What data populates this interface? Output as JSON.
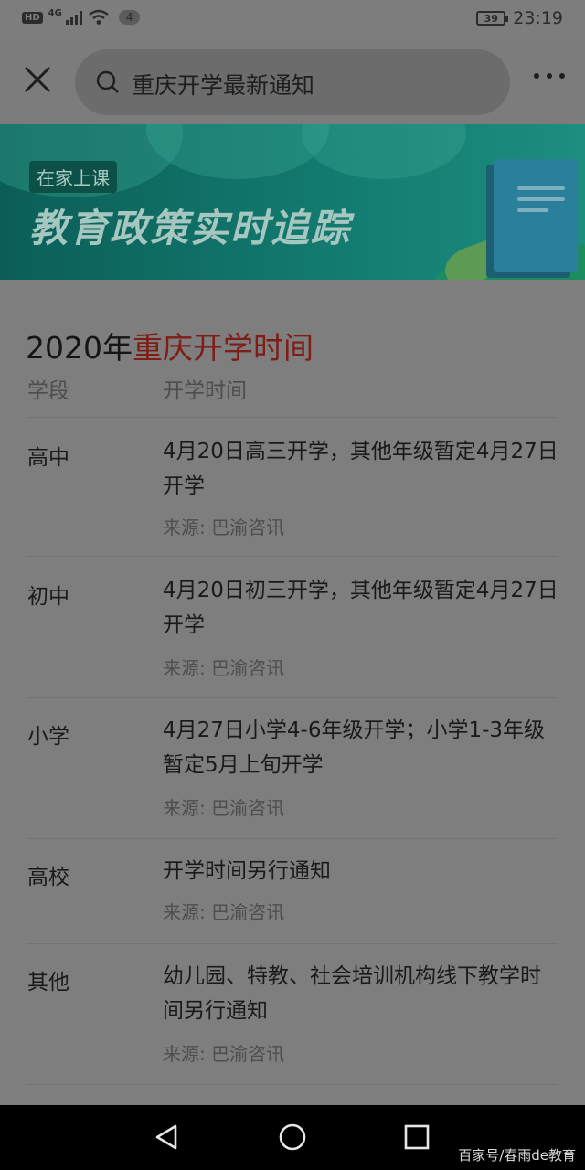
{
  "status_bar": {
    "hd": "HD",
    "network": "4G",
    "notification_count": "4",
    "battery": "39",
    "time": "23:19"
  },
  "search": {
    "query": "重庆开学最新通知"
  },
  "banner": {
    "tag": "在家上课",
    "title": "教育政策实时追踪"
  },
  "section": {
    "title_prefix": "2020年",
    "title_highlight": "重庆开学时间",
    "col_stage": "学段",
    "col_time": "开学时间"
  },
  "rows": [
    {
      "stage": "高中",
      "text": "4月20日高三开学，其他年级暂定4月27日开学",
      "source": "来源: 巴渝咨讯"
    },
    {
      "stage": "初中",
      "text": "4月20日初三开学，其他年级暂定4月27日开学",
      "source": "来源: 巴渝咨讯"
    },
    {
      "stage": "小学",
      "text": "4月27日小学4-6年级开学；小学1-3年级暂定5月上旬开学",
      "source": "来源: 巴渝咨讯"
    },
    {
      "stage": "高校",
      "text": "开学时间另行通知",
      "source": "来源: 巴渝咨讯"
    },
    {
      "stage": "其他",
      "text": "幼儿园、特教、社会培训机构线下教学时间另行通知",
      "source": "来源: 巴渝咨讯"
    }
  ],
  "watermark": "百家号/春雨de教育",
  "colors": {
    "highlight": "#7e1c15",
    "banner": "#127a6f"
  }
}
